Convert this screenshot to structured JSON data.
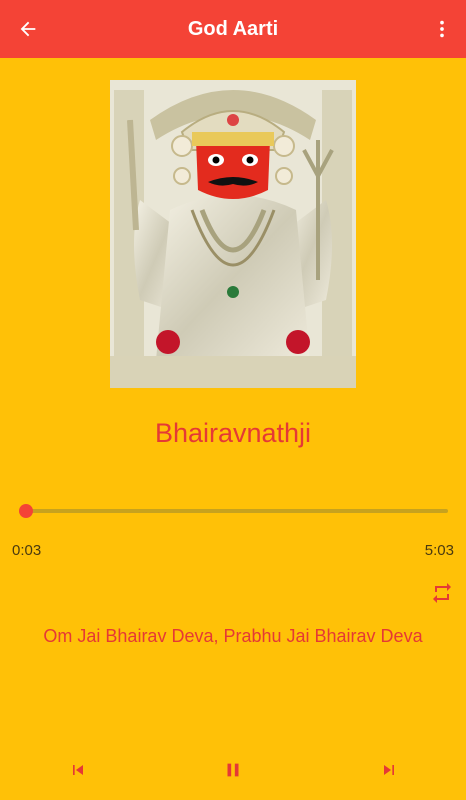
{
  "app_bar": {
    "title": "God Aarti",
    "back_icon": "arrow-back-icon",
    "menu_icon": "more-vert-icon",
    "color": "#F44336"
  },
  "player": {
    "song_title": "Bhairavnathji",
    "current_time": "0:03",
    "total_time": "5:03",
    "progress_fraction": 0.01,
    "lyric_line": "Om Jai Bhairav Deva, Prabhu Jai Bhairav Deva",
    "repeat_icon": "repeat-icon",
    "controls": {
      "previous_icon": "skip-previous-icon",
      "pause_icon": "pause-icon",
      "next_icon": "skip-next-icon"
    }
  },
  "colors": {
    "background": "#FFC107",
    "accent": "#F44336",
    "text_accent": "#E53935"
  }
}
